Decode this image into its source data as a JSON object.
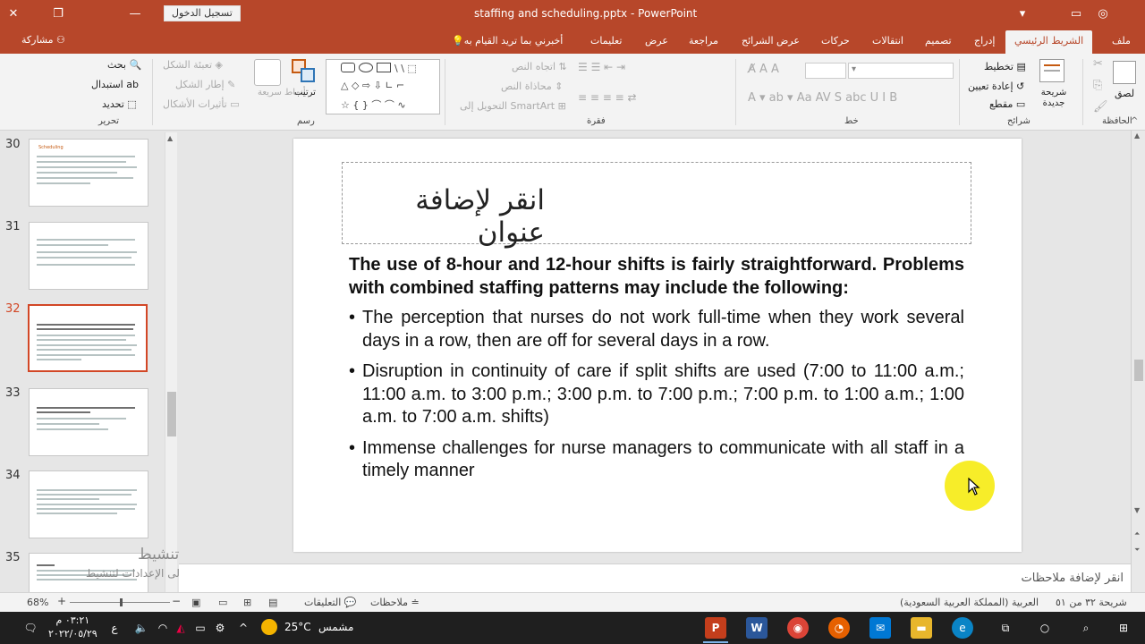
{
  "titlebar": {
    "file": "staffing and scheduling.pptx",
    "separator": "-",
    "app": "PowerPoint",
    "signin": "تسجيل الدخول"
  },
  "tabs": [
    {
      "id": "file",
      "label": "ملف"
    },
    {
      "id": "home",
      "label": "الشريط الرئيسي"
    },
    {
      "id": "insert",
      "label": "إدراج"
    },
    {
      "id": "design",
      "label": "تصميم"
    },
    {
      "id": "transitions",
      "label": "انتقالات"
    },
    {
      "id": "animations",
      "label": "حركات"
    },
    {
      "id": "slideshow",
      "label": "عرض الشرائح"
    },
    {
      "id": "review",
      "label": "مراجعة"
    },
    {
      "id": "view",
      "label": "عرض"
    },
    {
      "id": "help",
      "label": "تعليمات"
    },
    {
      "id": "tellme",
      "label": "أخبرني بما تريد القيام به"
    }
  ],
  "share": "مشاركة",
  "ribbon": {
    "clipboard": {
      "paste": "لصق",
      "label": "الحافظة"
    },
    "slides": {
      "new_slide": "شريحة جديدة",
      "layout": "تخطيط",
      "reset": "إعادة تعيين",
      "section": "مقطع",
      "label": "شرائح"
    },
    "font": {
      "label": "خط"
    },
    "paragraph": {
      "text_direction": "اتجاه النص",
      "align_text": "محاذاة النص",
      "smartart": "التحويل إلى SmartArt",
      "label": "فقرة"
    },
    "drawing": {
      "arrange": "ترتيب",
      "quick_styles": "أنماط سريعة",
      "shape_fill": "تعبئة الشكل",
      "shape_outline": "إطار الشكل",
      "shape_effects": "تأثيرات الأشكال",
      "label": "رسم"
    },
    "editing": {
      "find": "بحث",
      "replace": "استبدال",
      "select": "تحديد",
      "label": "تحرير"
    }
  },
  "thumbnails": [
    {
      "num": "30",
      "title": "Scheduling"
    },
    {
      "num": "31",
      "title": ""
    },
    {
      "num": "32",
      "title": ""
    },
    {
      "num": "33",
      "title": ""
    },
    {
      "num": "34",
      "title": ""
    },
    {
      "num": "35",
      "title": ""
    }
  ],
  "slide": {
    "title_placeholder": "انقر لإضافة عنوان",
    "intro": "The use of 8-hour and 12-hour shifts is fairly straightforward. Problems with combined staffing patterns may include the following:",
    "bullets": [
      "The perception that nurses do not work full-time when they work several days in a row, then are off for several days in a row.",
      "Disruption in continuity of care if split shifts are used (7:00 to 11:00 a.m.; 11:00 a.m. to 3:00 p.m.; 3:00 p.m. to 7:00 p.m.; 7:00 p.m. to 1:00 a.m.; 1:00 a.m. to 7:00 a.m. shifts)",
      "Immense challenges for nurse managers to communicate with all staff in a timely manner"
    ]
  },
  "notes_placeholder": "انقر لإضافة ملاحظات",
  "watermark": {
    "line1": "تنشيط Windows",
    "line2": "انتقل إلى الإعدادات لتنشيط Windows."
  },
  "statusbar": {
    "slide_counter": "شريحة ٣٢ من ٥١",
    "language": "العربية (المملكة العربية السعودية)",
    "notes": "ملاحظات",
    "comments": "التعليقات",
    "zoom": "68%"
  },
  "taskbar": {
    "weather_temp": "25°C",
    "weather_text": "مشمس",
    "time": "٠٣:٢١ م",
    "date": "٢٠٢٢/٠٥/٢٩"
  },
  "colors": {
    "accent": "#b7472a",
    "selected_thumb": "#d24726",
    "highlight": "#f7ec1d"
  }
}
